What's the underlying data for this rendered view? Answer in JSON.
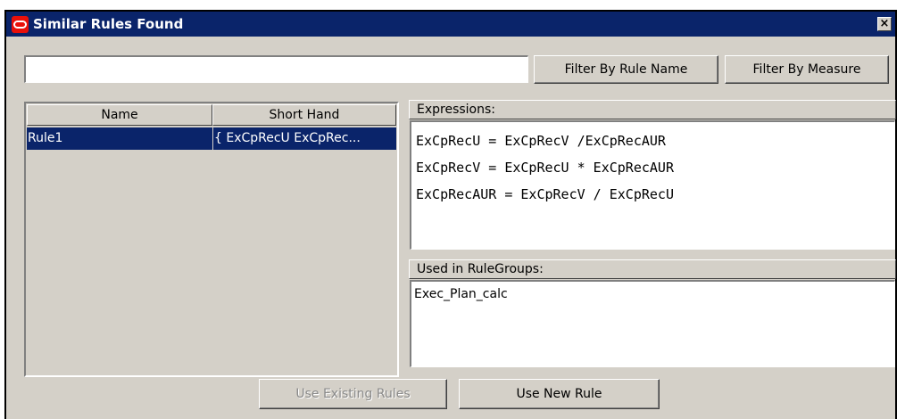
{
  "window": {
    "title": "Similar Rules Found",
    "icon": "oracle-logo-icon",
    "close_glyph": "×"
  },
  "filter": {
    "search_value": "",
    "filter_by_rule_name_label": "Filter By Rule Name",
    "filter_by_measure_label": "Filter By Measure"
  },
  "rules_table": {
    "columns": [
      "Name",
      "Short Hand"
    ],
    "rows": [
      {
        "name": "Rule1",
        "short_hand": "{ ExCpRecU ExCpRec...",
        "selected": true
      }
    ]
  },
  "expressions": {
    "header": "Expressions:",
    "lines": [
      "ExCpRecU = ExCpRecV /ExCpRecAUR",
      "ExCpRecV = ExCpRecU * ExCpRecAUR",
      "ExCpRecAUR = ExCpRecV / ExCpRecU"
    ]
  },
  "rulegroups": {
    "header": "Used in RuleGroups:",
    "items": [
      "Exec_Plan_calc"
    ]
  },
  "actions": {
    "use_existing_label": "Use Existing Rules",
    "use_existing_enabled": false,
    "use_new_label": "Use New Rule"
  },
  "colors": {
    "titlebar": "#0a246a",
    "selection": "#0a246a",
    "dialog_bg": "#d4d0c8",
    "logo_red": "#e8100a"
  }
}
